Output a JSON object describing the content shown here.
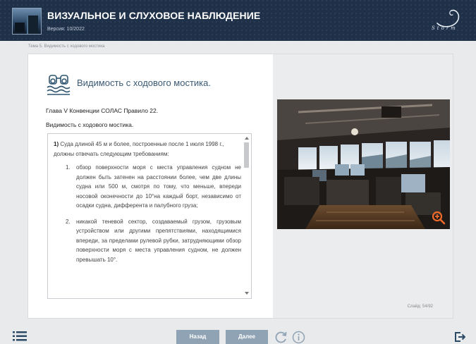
{
  "header": {
    "title": "ВИЗУАЛЬНОЕ И СЛУХОВОЕ НАБЛЮДЕНИЕ",
    "version": "Версия: 10/2022",
    "logo_text": "Storm",
    "thumbnail_icon": "ship-thumbnail"
  },
  "breadcrumb": "Тема 5. Видимость с ходового мостика",
  "content": {
    "title": "Видимость с ходового мостика.",
    "title_icon": "binoculars-icon",
    "subtitle1": "Глава V Конвенции СОЛАС Правило 22.",
    "subtitle2": "Видимость с ходового мостика.",
    "intro_num": "1)",
    "intro_text": " Суда длиной 45 м и более, построенные после 1 июля 1998 г., должны отвечать следующим требованиям:",
    "items": [
      {
        "num": "1.",
        "text": "обзор поверхности моря с места управления судном не должен быть затенен на расстоянии более, чем две длины судна или 500 м, смотря по тому, что меньше, впереди носовой оконечности до 10°на каждый борт, независимо от осадки судна, дифферента и палубного груза;"
      },
      {
        "num": "2.",
        "text": "никакой теневой сектор, создаваемый грузом, грузовым устройством или другими препятствиями, находящимися впереди, за пределами рулевой рубки, затрудняющими обзор поверхности моря с места управления судном, не должен превышать 10°."
      }
    ]
  },
  "image": {
    "description_icon": "ship-bridge-photo",
    "zoom_icon": "zoom-in-icon"
  },
  "slide_counter": "Слайд: 54/92",
  "nav": {
    "back_label": "Назад",
    "next_label": "Далее",
    "menu_icon": "menu-list-icon",
    "reload_icon": "reload-icon",
    "info_icon": "info-icon",
    "exit_icon": "exit-icon"
  },
  "colors": {
    "header_bg": "#1f3049",
    "button_bg": "#8fa3b4",
    "title_color": "#3a5a75",
    "zoom_accent": "#f06a2a"
  }
}
